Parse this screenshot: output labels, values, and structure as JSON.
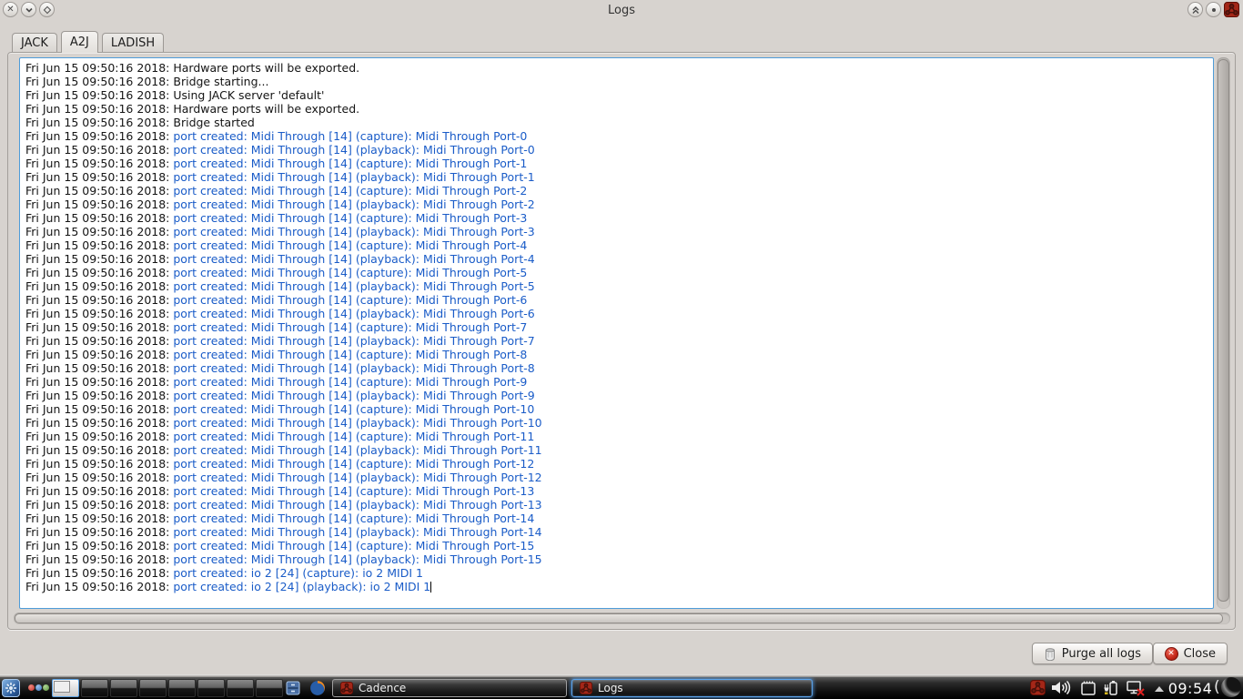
{
  "window": {
    "title": "Logs",
    "titlebar_left_buttons": [
      "close-icon",
      "shade-icon",
      "maximize-icon"
    ],
    "titlebar_right_buttons": [
      "keep-above-icon",
      "pin-icon",
      "app-icon"
    ]
  },
  "tabs": [
    {
      "label": "JACK",
      "active": false
    },
    {
      "label": "A2J",
      "active": true
    },
    {
      "label": "LADISH",
      "active": false
    }
  ],
  "log": {
    "timestamp": "Fri Jun 15 09:50:16 2018:",
    "lines": [
      {
        "message": "Hardware ports will be exported.",
        "link": false
      },
      {
        "message": "Bridge starting...",
        "link": false
      },
      {
        "message": "Using JACK server 'default'",
        "link": false
      },
      {
        "message": "Hardware ports will be exported.",
        "link": false
      },
      {
        "message": "Bridge started",
        "link": false
      },
      {
        "message": "port created: Midi Through [14] (capture): Midi Through Port-0",
        "link": true
      },
      {
        "message": "port created: Midi Through [14] (playback): Midi Through Port-0",
        "link": true
      },
      {
        "message": "port created: Midi Through [14] (capture): Midi Through Port-1",
        "link": true
      },
      {
        "message": "port created: Midi Through [14] (playback): Midi Through Port-1",
        "link": true
      },
      {
        "message": "port created: Midi Through [14] (capture): Midi Through Port-2",
        "link": true
      },
      {
        "message": "port created: Midi Through [14] (playback): Midi Through Port-2",
        "link": true
      },
      {
        "message": "port created: Midi Through [14] (capture): Midi Through Port-3",
        "link": true
      },
      {
        "message": "port created: Midi Through [14] (playback): Midi Through Port-3",
        "link": true
      },
      {
        "message": "port created: Midi Through [14] (capture): Midi Through Port-4",
        "link": true
      },
      {
        "message": "port created: Midi Through [14] (playback): Midi Through Port-4",
        "link": true
      },
      {
        "message": "port created: Midi Through [14] (capture): Midi Through Port-5",
        "link": true
      },
      {
        "message": "port created: Midi Through [14] (playback): Midi Through Port-5",
        "link": true
      },
      {
        "message": "port created: Midi Through [14] (capture): Midi Through Port-6",
        "link": true
      },
      {
        "message": "port created: Midi Through [14] (playback): Midi Through Port-6",
        "link": true
      },
      {
        "message": "port created: Midi Through [14] (capture): Midi Through Port-7",
        "link": true
      },
      {
        "message": "port created: Midi Through [14] (playback): Midi Through Port-7",
        "link": true
      },
      {
        "message": "port created: Midi Through [14] (capture): Midi Through Port-8",
        "link": true
      },
      {
        "message": "port created: Midi Through [14] (playback): Midi Through Port-8",
        "link": true
      },
      {
        "message": "port created: Midi Through [14] (capture): Midi Through Port-9",
        "link": true
      },
      {
        "message": "port created: Midi Through [14] (playback): Midi Through Port-9",
        "link": true
      },
      {
        "message": "port created: Midi Through [14] (capture): Midi Through Port-10",
        "link": true
      },
      {
        "message": "port created: Midi Through [14] (playback): Midi Through Port-10",
        "link": true
      },
      {
        "message": "port created: Midi Through [14] (capture): Midi Through Port-11",
        "link": true
      },
      {
        "message": "port created: Midi Through [14] (playback): Midi Through Port-11",
        "link": true
      },
      {
        "message": "port created: Midi Through [14] (capture): Midi Through Port-12",
        "link": true
      },
      {
        "message": "port created: Midi Through [14] (playback): Midi Through Port-12",
        "link": true
      },
      {
        "message": "port created: Midi Through [14] (capture): Midi Through Port-13",
        "link": true
      },
      {
        "message": "port created: Midi Through [14] (playback): Midi Through Port-13",
        "link": true
      },
      {
        "message": "port created: Midi Through [14] (capture): Midi Through Port-14",
        "link": true
      },
      {
        "message": "port created: Midi Through [14] (playback): Midi Through Port-14",
        "link": true
      },
      {
        "message": "port created: Midi Through [14] (capture): Midi Through Port-15",
        "link": true
      },
      {
        "message": "port created: Midi Through [14] (playback): Midi Through Port-15",
        "link": true
      },
      {
        "message": "port created: io 2 [24] (capture): io 2 MIDI 1",
        "link": true
      },
      {
        "message": "port created: io 2 [24] (playback): io 2 MIDI 1",
        "link": true,
        "cursor": true
      }
    ]
  },
  "footer": {
    "purge_button": "Purge all logs",
    "close_button": "Close"
  },
  "taskbar": {
    "pager": {
      "desktops": 8,
      "active_index": 0
    },
    "launcher_icons": [
      "menu-icon",
      "red-dot",
      "blue-dot",
      "green-dot",
      "drawer-icon",
      "firefox-icon"
    ],
    "task_buttons": [
      {
        "label": "Cadence",
        "active": false
      },
      {
        "label": "Logs",
        "active": true
      }
    ],
    "tray_icons": [
      "cadence-icon",
      "volume-icon",
      "clipboard-icon",
      "battery-icon",
      "network-offline-icon",
      "hide-panel-icon",
      "moon-icon"
    ],
    "clock": "09:54"
  },
  "colors": {
    "link_blue": "#1a5cc8",
    "focus_border": "#4f9cd8",
    "active_task_border": "#5ba4ec",
    "app_icon_red": "#a42718",
    "window_bg": "#d7d3cf",
    "taskbar_bg": "#000000"
  }
}
